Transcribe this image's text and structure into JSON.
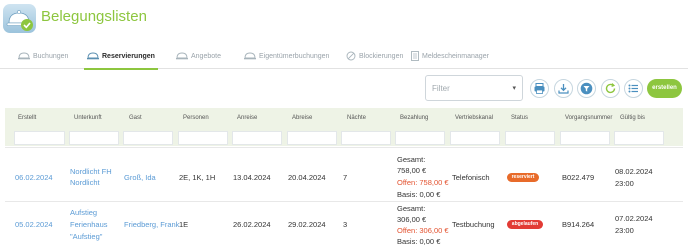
{
  "app": {
    "title": "Belegungslisten"
  },
  "tabs": [
    {
      "label": "Buchungen",
      "icon": "bell-icon"
    },
    {
      "label": "Reservierungen",
      "icon": "bell-icon",
      "active": true
    },
    {
      "label": "Angebote",
      "icon": "bell-icon"
    },
    {
      "label": "Eigentümerbuchungen",
      "icon": "bell-icon"
    },
    {
      "label": "Blockierungen",
      "icon": "block-icon"
    },
    {
      "label": "Meldescheinmanager",
      "icon": "document-icon"
    }
  ],
  "toolbar": {
    "filter_placeholder": "Filter",
    "create_label": "erstellen",
    "icons": [
      "print-icon",
      "download-icon",
      "filter-icon",
      "refresh-icon",
      "list-icon"
    ]
  },
  "table": {
    "columns": [
      "Erstellt",
      "Unterkunft",
      "Gast",
      "Personen",
      "Anreise",
      "Abreise",
      "Nächte",
      "Bezahlung",
      "Vertriebskanal",
      "Status",
      "Vorgangsnummer",
      "Gültig bis"
    ],
    "rows": [
      {
        "erstellt": "06.02.2024",
        "unterkunft": [
          "Nordlicht FH",
          "Nordlicht"
        ],
        "gast": "Groß, Ida",
        "personen": "2E, 1K, 1H",
        "anreise": "13.04.2024",
        "abreise": "20.04.2024",
        "naechte": "7",
        "bezahlung": {
          "gesamt_label": "Gesamt:",
          "gesamt": "758,00 €",
          "offen": "Offen: 758,00 €",
          "basis": "Basis: 0,00 €"
        },
        "vertriebskanal": "Telefonisch",
        "status": "reserviert",
        "vorgangsnummer": "B022.479",
        "gueltig_bis": [
          "08.02.2024",
          "23:00"
        ]
      },
      {
        "erstellt": "05.02.2024",
        "unterkunft": [
          "Aufstieg",
          "Ferienhaus",
          "\"Aufstieg\""
        ],
        "gast": "Friedberg, Frank",
        "personen": "1E",
        "anreise": "26.02.2024",
        "abreise": "29.02.2024",
        "naechte": "3",
        "bezahlung": {
          "gesamt_label": "Gesamt:",
          "gesamt": "306,00 €",
          "offen": "Offen: 306,00 €",
          "basis": "Basis: 0,00 €"
        },
        "vertriebskanal": "Testbuchung",
        "status": "abgelaufen",
        "vorgangsnummer": "B914.264",
        "gueltig_bis": [
          "07.02.2024",
          "23:00"
        ]
      }
    ]
  },
  "colors": {
    "accent": "#8dc63f",
    "link": "#5b9bd5",
    "offen": "#e3522f",
    "reserviert": "#e86b2a",
    "abgelaufen": "#e23b35"
  }
}
